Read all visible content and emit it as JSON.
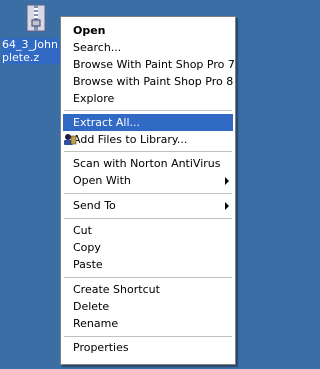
{
  "desktop": {
    "file_label_line1": "64_3_John",
    "file_label_line2": "plete.z"
  },
  "menu": {
    "items": [
      {
        "label": "Open"
      },
      {
        "label": "Search..."
      },
      {
        "label": "Browse With Paint Shop Pro 7"
      },
      {
        "label": "Browse with Paint Shop Pro 8"
      },
      {
        "label": "Explore"
      },
      {
        "label": "Extract All..."
      },
      {
        "label": "Add Files to Library..."
      },
      {
        "label": "Scan with Norton AntiVirus"
      },
      {
        "label": "Open With"
      },
      {
        "label": "Send To"
      },
      {
        "label": "Cut"
      },
      {
        "label": "Copy"
      },
      {
        "label": "Paste"
      },
      {
        "label": "Create Shortcut"
      },
      {
        "label": "Delete"
      },
      {
        "label": "Rename"
      },
      {
        "label": "Properties"
      }
    ],
    "highlight_color": "#316ac5",
    "background_color": "#ffffff"
  },
  "icons": {
    "file": "zip-archive-icon",
    "library": "library-icon"
  }
}
